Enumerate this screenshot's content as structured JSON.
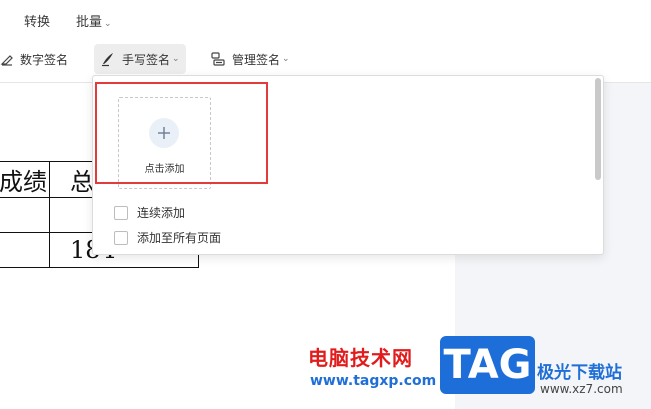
{
  "menu": {
    "convert": "转换",
    "batch": "批量"
  },
  "toolbar": {
    "digital_signature": "数字签名",
    "handwritten_signature": "手写签名",
    "manage_signature": "管理签名"
  },
  "document": {
    "header_cell_1": "成绩",
    "header_cell_2": "总",
    "row3_cell_2": "184"
  },
  "popup": {
    "add_label": "点击添加",
    "options": [
      {
        "label": "连续添加",
        "checked": false
      },
      {
        "label": "添加至所有页面",
        "checked": false
      }
    ]
  },
  "watermark": {
    "site_name": "电脑技术网",
    "site_url": "www.tagxp.com",
    "logo_text": "TAG",
    "right_title": "极光下载站",
    "right_url": "www.xz7.com"
  },
  "colors": {
    "highlight_red": "#e33b3b",
    "logo_blue": "#1d6ed8"
  },
  "icons": {
    "handwrite": "pen-icon",
    "digital": "digital-signature-icon",
    "manage": "manage-signature-icon",
    "add": "plus-icon",
    "dropdown": "chevron-down-icon"
  }
}
